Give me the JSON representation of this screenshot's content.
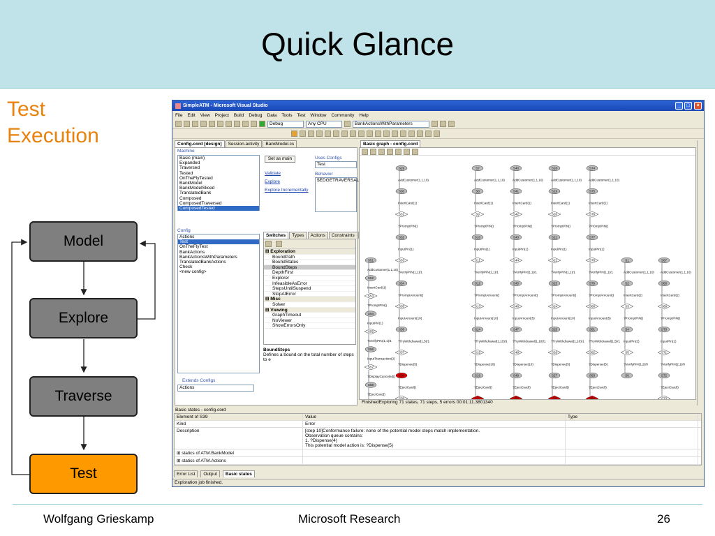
{
  "slide": {
    "title": "Quick Glance",
    "side_title": "Test\nExecution",
    "footer_left": "Wolfgang Grieskamp",
    "footer_center": "Microsoft Research",
    "footer_right": "26"
  },
  "flow": {
    "boxes": [
      "Model",
      "Explore",
      "Traverse",
      "Test"
    ],
    "active": "Test",
    "colors": {
      "inactive": "#7f7f7f",
      "active": "#ff9900"
    }
  },
  "vs": {
    "window_title": "SimpleATM - Microsoft Visual Studio",
    "menu": [
      "File",
      "Edit",
      "View",
      "Project",
      "Build",
      "Debug",
      "Data",
      "Tools",
      "Test",
      "Window",
      "Community",
      "Help"
    ],
    "toolbar": {
      "config": "Debug",
      "platform": "Any CPU",
      "combo": "BankActionsWithParameters"
    },
    "left_tabs": [
      "Config.cord [design]",
      "Session.activity",
      "BankModel.cs"
    ],
    "machine": {
      "header": "Machine",
      "items": [
        "Basic (main)",
        "Expanded",
        "Traversed",
        "Tested",
        "OnTheFlyTested",
        "BankModel",
        "BankModelSliced",
        "TranslatedBank",
        "Composed",
        "ComposedTraversed",
        "ComposedTested"
      ],
      "selected": "ComposedTested",
      "set_main": "Set as main",
      "uses_configs": "Uses Configs",
      "uses_value": "Test",
      "behavior": "Behavior",
      "behavior_value": "$EDGETRAVERSAL(C",
      "links": [
        "Validate",
        "Explore",
        "Explore Incrementally"
      ]
    },
    "config": {
      "header": "Config",
      "items": [
        "Actions",
        "Test",
        "OnTheFlyTest",
        "BankActions",
        "BankActionsWithParameters",
        "TranslatedBankActions",
        "Check",
        "<new config>"
      ],
      "selected": "Test",
      "extends_label": "Extends Configs",
      "extends_value": "Actions"
    },
    "switches": {
      "tabs": [
        "Switches",
        "Types",
        "Actions",
        "Constraints",
        "Excep"
      ],
      "rows": [
        {
          "name": "Exploration",
          "cat": true
        },
        {
          "name": "BoundPath"
        },
        {
          "name": "BoundStates"
        },
        {
          "name": "BoundSteps",
          "sel": true
        },
        {
          "name": "DepthFirst"
        },
        {
          "name": "Explorer"
        },
        {
          "name": "InfeasibleAsError"
        },
        {
          "name": "StepsUntilSuspend"
        },
        {
          "name": "StopAtError"
        },
        {
          "name": "Misc",
          "cat": true
        },
        {
          "name": "Solver"
        },
        {
          "name": "Viewing",
          "cat": true
        },
        {
          "name": "GraphTimeout"
        },
        {
          "name": "NoViewer"
        },
        {
          "name": "ShowErrorsOnly"
        }
      ],
      "desc_title": "BoundSteps",
      "desc_text": "Defines a bound on the total number of steps to e"
    },
    "graph": {
      "tab": "Basic graph - config.cord",
      "status": "FinishedExploring  71 states, 71 steps, 5 errors  00:01:11.3801340",
      "columns": [
        {
          "top": "S29",
          "states": [
            "S29",
            "S30",
            "S31",
            "S32",
            "S33",
            "S34",
            "S35",
            "S36",
            "S37",
            "S38",
            "S39"
          ],
          "labels": [
            "AddCustomer(1,1,10)",
            "InsertCard(1)",
            "?PromptPIN()",
            "InputPin(1)",
            "?VerifyPIN(1,1)/1",
            "?PromptAmount()",
            "InputAmount(10)",
            "?TryWithdrawal(1,5)/1",
            "?Dispense(5)",
            "?EjectCard()"
          ]
        },
        {
          "top": "S7",
          "states": [
            "S7",
            "S8",
            "S9",
            "S10",
            "S11",
            "S12",
            "S13",
            "S14",
            "S15",
            "S16",
            "S17"
          ],
          "labels": [
            "AddCustomer(1,1,10)",
            "InsertCard(1)",
            "?PromptPIN()",
            "InputPin(1)",
            "?VerifyPIN(1,1)/1",
            "?PromptAmount()",
            "InputAmount(10)",
            "?TryWithdrawal(1,10)/1",
            "?Dispense(10)",
            "?EjectCard()"
          ]
        },
        {
          "top": "S40",
          "states": [
            "S40",
            "S41",
            "S42",
            "S43",
            "S44",
            "S45",
            "S46",
            "S47",
            "S48",
            "S49",
            "S50"
          ],
          "labels": [
            "AddCustomer(1,1,10)",
            "InsertCard(1)",
            "?PromptPIN()",
            "InputPin(1)",
            "?VerifyPIN(1,1)/1",
            "?PromptAmount()",
            "InputAmount(5)",
            "?TryWithdrawal(1,10)/1",
            "?Dispense(10)",
            "?EjectCard()"
          ]
        },
        {
          "top": "S18",
          "states": [
            "S18",
            "S19",
            "S20",
            "S21",
            "S22",
            "S23",
            "S24",
            "S25",
            "S26",
            "S27",
            "S28"
          ],
          "labels": [
            "AddCustomer(1,1,10)",
            "InsertCard(1)",
            "?PromptPIN()",
            "InputPin(1)",
            "?VerifyPIN(1,1)/1",
            "?PromptAmount()",
            "InputAmount(10)",
            "?TryWithdrawal(1,10)/1",
            "?Dispense(5)",
            "?EjectCard()"
          ]
        },
        {
          "top": "S74",
          "states": [
            "S74",
            "S75",
            "S76",
            "S77",
            "S78",
            "S79",
            "S80",
            "S81",
            "S82",
            "S83",
            "S84"
          ],
          "labels": [
            "AddCustomer(1,1,10)",
            "InsertCard(1)",
            "?PromptPIN()",
            "InputPin(1)",
            "?VerifyPIN(1,1)/1",
            "?PromptAmount()",
            "InputAmount(5)",
            "?TryWithdrawal(1,5)/1",
            "?Dispense(5)",
            "?EjectCard()"
          ]
        }
      ],
      "left_column": {
        "states": [
          "S51",
          "S52",
          "S53",
          "S54",
          "S55",
          "S56",
          "S57",
          "S58",
          "S59"
        ],
        "labels": [
          "AddCustomer(1,1,10)",
          "InsertCard(1)",
          "?PromptPIN()",
          "InputPin(1)",
          "?VerifyPIN(1,1)/1",
          "InputTransaction(2)",
          "?DisplayCanceled()",
          "?EjectCard()"
        ]
      },
      "error_states": [
        "S38",
        "S17",
        "S50",
        "S28",
        "S84"
      ]
    },
    "basic_states": {
      "header": "Basic states - config.cord",
      "columns": [
        "Element of S39",
        "Value",
        "Type"
      ],
      "rows": [
        {
          "name": "Kind",
          "value": "Error",
          "type": ""
        },
        {
          "name": "Description",
          "value": "[step 10]Conformance failure: none of the potential model steps match implementation.\nObservation queue contains:\n  1. ?Dispense(4)\nThis potential model action is: ?Dispense(5)",
          "type": ""
        },
        {
          "name": "statics of ATM.BankModel",
          "value": "",
          "type": ""
        },
        {
          "name": "statics of ATM.Actions",
          "value": "",
          "type": ""
        }
      ]
    },
    "bottom_tabs": [
      "Error List",
      "Output",
      "Basic states"
    ],
    "status": "Exploration job finished."
  }
}
